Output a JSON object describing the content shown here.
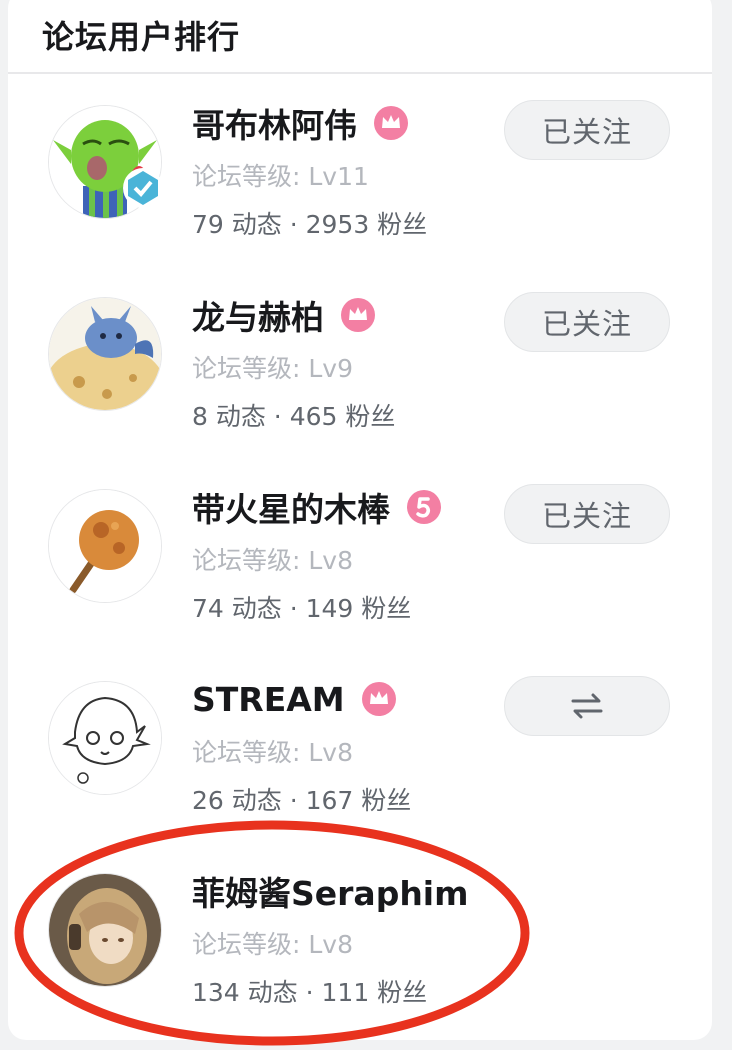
{
  "header": {
    "title": "论坛用户排行"
  },
  "users": [
    {
      "name": "哥布林阿伟",
      "level": "论坛等级: Lv11",
      "stats": "79 动态 · 2953 粉丝",
      "follow_label": "已关注",
      "badge_icon": "crown-badge-icon",
      "verified": true
    },
    {
      "name": "龙与赫柏",
      "level": "论坛等级: Lv9",
      "stats": "8 动态 · 465 粉丝",
      "follow_label": "已关注",
      "badge_icon": "crown-badge-icon",
      "verified": false
    },
    {
      "name": "带火星的木棒",
      "level": "论坛等级: Lv8",
      "stats": "74 动态 · 149 粉丝",
      "follow_label": "已关注",
      "badge_icon": "level-5-badge-icon",
      "verified": false
    },
    {
      "name": "STREAM",
      "level": "论坛等级: Lv8",
      "stats": "26 动态 · 167 粉丝",
      "follow_label": "",
      "follow_icon": "mutual-follow-icon",
      "badge_icon": "crown-badge-icon",
      "verified": false
    },
    {
      "name": "菲姆酱Seraphim",
      "level": "论坛等级: Lv8",
      "stats": "134 动态 · 111 粉丝",
      "badge_icon": "",
      "verified": false
    }
  ],
  "colors": {
    "badge_pink": "#f37fa3",
    "verify_blue": "#4ab4d8",
    "highlight_red": "#e8321e",
    "level_gray": "#b4b7bd",
    "stats_gray": "#61666d"
  }
}
